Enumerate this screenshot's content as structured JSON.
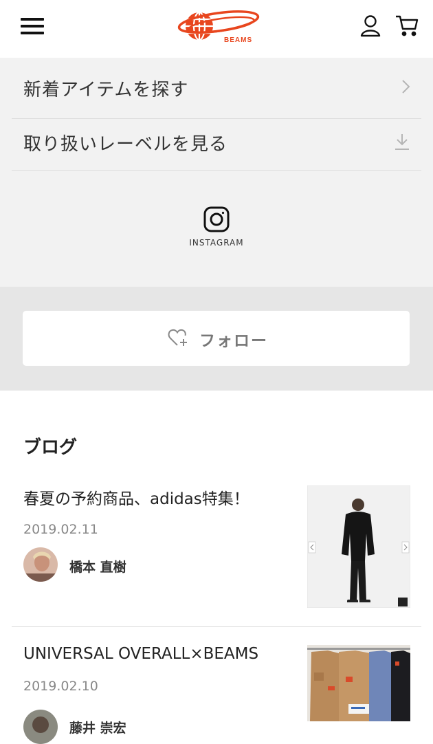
{
  "header": {
    "menu_icon": "hamburger-menu-icon",
    "logo_text": "BEAMS",
    "account_icon": "user-icon",
    "cart_icon": "cart-icon",
    "brand_color": "#e8461e"
  },
  "menu": {
    "items": [
      {
        "label": "新着アイテムを探す",
        "icon": "chevron-right-icon"
      },
      {
        "label": "取り扱いレーベルを見る",
        "icon": "download-arrow-icon"
      }
    ]
  },
  "social": {
    "instagram_label": "INSTAGRAM",
    "icon": "instagram-icon"
  },
  "follow": {
    "label": "フォロー",
    "icon": "heart-plus-icon"
  },
  "blog": {
    "title": "ブログ",
    "posts": [
      {
        "title": "春夏の予約商品、adidas特集！",
        "date": "2019.02.11",
        "author": "橋本 直樹"
      },
      {
        "title": "UNIVERSAL OVERALL×BEAMS",
        "date": "2019.02.10",
        "author": "藤井 崇宏"
      }
    ]
  }
}
